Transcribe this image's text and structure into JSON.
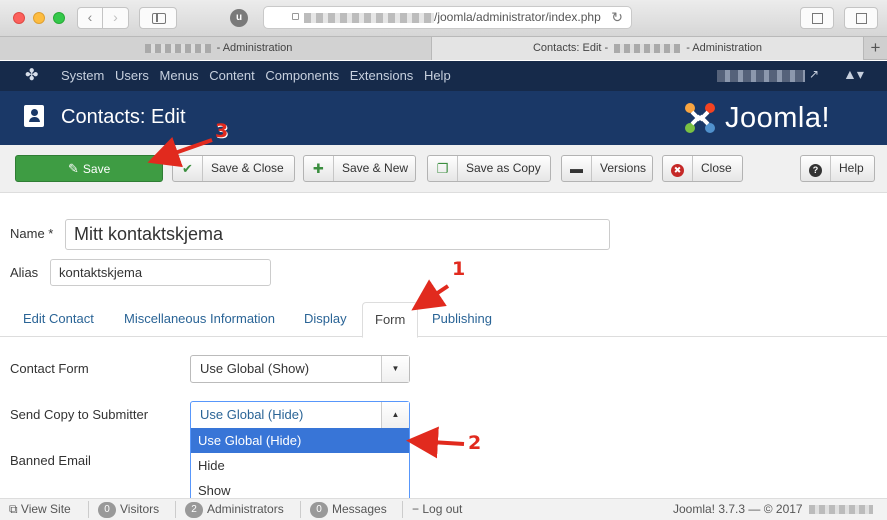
{
  "browser": {
    "url": "/joomla/administrator/index.php",
    "tabs": [
      {
        "label": "- Administration"
      },
      {
        "label_prefix": "Contacts: Edit -",
        "label_suffix": "- Administration"
      }
    ],
    "ublock_label": "u",
    "new_tab_label": "+"
  },
  "nav": {
    "items": [
      "System",
      "Users",
      "Menus",
      "Content",
      "Components",
      "Extensions",
      "Help"
    ]
  },
  "header": {
    "title": "Contacts: Edit",
    "brand": "Joomla!"
  },
  "toolbar": {
    "save": "Save",
    "save_close": "Save & Close",
    "save_new": "Save & New",
    "save_copy": "Save as Copy",
    "versions": "Versions",
    "close": "Close",
    "help": "Help"
  },
  "form": {
    "name_label": "Name *",
    "name_value": "Mitt kontaktskjema",
    "alias_label": "Alias",
    "alias_value": "kontaktskjema",
    "tabs": [
      "Edit Contact",
      "Miscellaneous Information",
      "Display",
      "Form",
      "Publishing"
    ],
    "active_tab": "Form",
    "contact_form_label": "Contact Form",
    "contact_form_value": "Use Global (Show)",
    "send_copy_label": "Send Copy to Submitter",
    "send_copy_value": "Use Global (Hide)",
    "send_copy_options": [
      "Use Global (Hide)",
      "Hide",
      "Show"
    ],
    "banned_email_label": "Banned Email"
  },
  "status": {
    "view_site": "View Site",
    "visitors_count": "0",
    "visitors": "Visitors",
    "admins_count": "2",
    "admins": "Administrators",
    "messages_count": "0",
    "messages": "Messages",
    "logout": "Log out",
    "version": "Joomla! 3.7.3",
    "copyright": "— © 2017"
  },
  "annotations": [
    "1",
    "2",
    "3"
  ],
  "colors": {
    "nav_bg": "#162a4a",
    "header_bg": "#1a3867",
    "save_green": "#3e9c43",
    "link_blue": "#2a6496",
    "highlight": "#3875d7",
    "annotation_red": "#e12a1e"
  }
}
